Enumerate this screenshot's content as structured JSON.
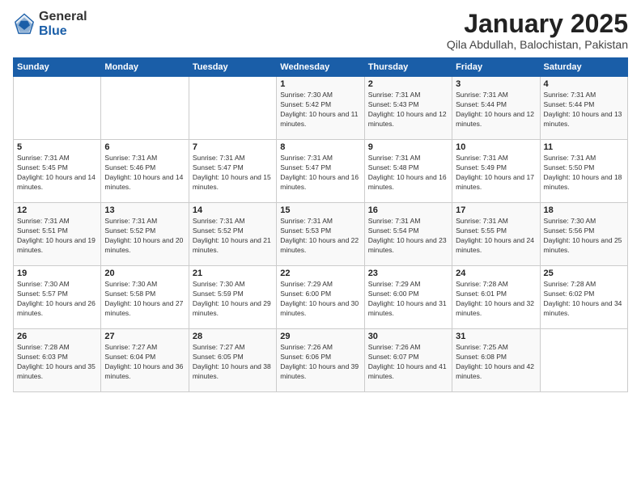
{
  "logo": {
    "general": "General",
    "blue": "Blue"
  },
  "title": "January 2025",
  "subtitle": "Qila Abdullah, Balochistan, Pakistan",
  "days_header": [
    "Sunday",
    "Monday",
    "Tuesday",
    "Wednesday",
    "Thursday",
    "Friday",
    "Saturday"
  ],
  "weeks": [
    [
      {
        "day": "",
        "sunrise": "",
        "sunset": "",
        "daylight": ""
      },
      {
        "day": "",
        "sunrise": "",
        "sunset": "",
        "daylight": ""
      },
      {
        "day": "",
        "sunrise": "",
        "sunset": "",
        "daylight": ""
      },
      {
        "day": "1",
        "sunrise": "Sunrise: 7:30 AM",
        "sunset": "Sunset: 5:42 PM",
        "daylight": "Daylight: 10 hours and 11 minutes."
      },
      {
        "day": "2",
        "sunrise": "Sunrise: 7:31 AM",
        "sunset": "Sunset: 5:43 PM",
        "daylight": "Daylight: 10 hours and 12 minutes."
      },
      {
        "day": "3",
        "sunrise": "Sunrise: 7:31 AM",
        "sunset": "Sunset: 5:44 PM",
        "daylight": "Daylight: 10 hours and 12 minutes."
      },
      {
        "day": "4",
        "sunrise": "Sunrise: 7:31 AM",
        "sunset": "Sunset: 5:44 PM",
        "daylight": "Daylight: 10 hours and 13 minutes."
      }
    ],
    [
      {
        "day": "5",
        "sunrise": "Sunrise: 7:31 AM",
        "sunset": "Sunset: 5:45 PM",
        "daylight": "Daylight: 10 hours and 14 minutes."
      },
      {
        "day": "6",
        "sunrise": "Sunrise: 7:31 AM",
        "sunset": "Sunset: 5:46 PM",
        "daylight": "Daylight: 10 hours and 14 minutes."
      },
      {
        "day": "7",
        "sunrise": "Sunrise: 7:31 AM",
        "sunset": "Sunset: 5:47 PM",
        "daylight": "Daylight: 10 hours and 15 minutes."
      },
      {
        "day": "8",
        "sunrise": "Sunrise: 7:31 AM",
        "sunset": "Sunset: 5:47 PM",
        "daylight": "Daylight: 10 hours and 16 minutes."
      },
      {
        "day": "9",
        "sunrise": "Sunrise: 7:31 AM",
        "sunset": "Sunset: 5:48 PM",
        "daylight": "Daylight: 10 hours and 16 minutes."
      },
      {
        "day": "10",
        "sunrise": "Sunrise: 7:31 AM",
        "sunset": "Sunset: 5:49 PM",
        "daylight": "Daylight: 10 hours and 17 minutes."
      },
      {
        "day": "11",
        "sunrise": "Sunrise: 7:31 AM",
        "sunset": "Sunset: 5:50 PM",
        "daylight": "Daylight: 10 hours and 18 minutes."
      }
    ],
    [
      {
        "day": "12",
        "sunrise": "Sunrise: 7:31 AM",
        "sunset": "Sunset: 5:51 PM",
        "daylight": "Daylight: 10 hours and 19 minutes."
      },
      {
        "day": "13",
        "sunrise": "Sunrise: 7:31 AM",
        "sunset": "Sunset: 5:52 PM",
        "daylight": "Daylight: 10 hours and 20 minutes."
      },
      {
        "day": "14",
        "sunrise": "Sunrise: 7:31 AM",
        "sunset": "Sunset: 5:52 PM",
        "daylight": "Daylight: 10 hours and 21 minutes."
      },
      {
        "day": "15",
        "sunrise": "Sunrise: 7:31 AM",
        "sunset": "Sunset: 5:53 PM",
        "daylight": "Daylight: 10 hours and 22 minutes."
      },
      {
        "day": "16",
        "sunrise": "Sunrise: 7:31 AM",
        "sunset": "Sunset: 5:54 PM",
        "daylight": "Daylight: 10 hours and 23 minutes."
      },
      {
        "day": "17",
        "sunrise": "Sunrise: 7:31 AM",
        "sunset": "Sunset: 5:55 PM",
        "daylight": "Daylight: 10 hours and 24 minutes."
      },
      {
        "day": "18",
        "sunrise": "Sunrise: 7:30 AM",
        "sunset": "Sunset: 5:56 PM",
        "daylight": "Daylight: 10 hours and 25 minutes."
      }
    ],
    [
      {
        "day": "19",
        "sunrise": "Sunrise: 7:30 AM",
        "sunset": "Sunset: 5:57 PM",
        "daylight": "Daylight: 10 hours and 26 minutes."
      },
      {
        "day": "20",
        "sunrise": "Sunrise: 7:30 AM",
        "sunset": "Sunset: 5:58 PM",
        "daylight": "Daylight: 10 hours and 27 minutes."
      },
      {
        "day": "21",
        "sunrise": "Sunrise: 7:30 AM",
        "sunset": "Sunset: 5:59 PM",
        "daylight": "Daylight: 10 hours and 29 minutes."
      },
      {
        "day": "22",
        "sunrise": "Sunrise: 7:29 AM",
        "sunset": "Sunset: 6:00 PM",
        "daylight": "Daylight: 10 hours and 30 minutes."
      },
      {
        "day": "23",
        "sunrise": "Sunrise: 7:29 AM",
        "sunset": "Sunset: 6:00 PM",
        "daylight": "Daylight: 10 hours and 31 minutes."
      },
      {
        "day": "24",
        "sunrise": "Sunrise: 7:28 AM",
        "sunset": "Sunset: 6:01 PM",
        "daylight": "Daylight: 10 hours and 32 minutes."
      },
      {
        "day": "25",
        "sunrise": "Sunrise: 7:28 AM",
        "sunset": "Sunset: 6:02 PM",
        "daylight": "Daylight: 10 hours and 34 minutes."
      }
    ],
    [
      {
        "day": "26",
        "sunrise": "Sunrise: 7:28 AM",
        "sunset": "Sunset: 6:03 PM",
        "daylight": "Daylight: 10 hours and 35 minutes."
      },
      {
        "day": "27",
        "sunrise": "Sunrise: 7:27 AM",
        "sunset": "Sunset: 6:04 PM",
        "daylight": "Daylight: 10 hours and 36 minutes."
      },
      {
        "day": "28",
        "sunrise": "Sunrise: 7:27 AM",
        "sunset": "Sunset: 6:05 PM",
        "daylight": "Daylight: 10 hours and 38 minutes."
      },
      {
        "day": "29",
        "sunrise": "Sunrise: 7:26 AM",
        "sunset": "Sunset: 6:06 PM",
        "daylight": "Daylight: 10 hours and 39 minutes."
      },
      {
        "day": "30",
        "sunrise": "Sunrise: 7:26 AM",
        "sunset": "Sunset: 6:07 PM",
        "daylight": "Daylight: 10 hours and 41 minutes."
      },
      {
        "day": "31",
        "sunrise": "Sunrise: 7:25 AM",
        "sunset": "Sunset: 6:08 PM",
        "daylight": "Daylight: 10 hours and 42 minutes."
      },
      {
        "day": "",
        "sunrise": "",
        "sunset": "",
        "daylight": ""
      }
    ]
  ]
}
